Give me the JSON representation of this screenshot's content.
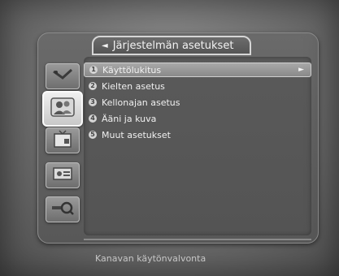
{
  "header": {
    "title": "Järjestelmän asetukset",
    "back_arrow": "◄"
  },
  "menu": {
    "items": [
      {
        "num": "1",
        "label": "Käyttölukitus",
        "selected": true
      },
      {
        "num": "2",
        "label": "Kielten asetus",
        "selected": false
      },
      {
        "num": "3",
        "label": "Kellonajan asetus",
        "selected": false
      },
      {
        "num": "4",
        "label": "Ääni ja kuva",
        "selected": false
      },
      {
        "num": "5",
        "label": "Muut asetukset",
        "selected": false
      }
    ],
    "submenu_arrow": "►"
  },
  "sidebar": {
    "icons": [
      {
        "name": "satellite-dish-icon"
      },
      {
        "name": "user-settings-icon",
        "active": true
      },
      {
        "name": "tv-channel-icon"
      },
      {
        "name": "media-card-icon"
      },
      {
        "name": "search-key-icon"
      }
    ]
  },
  "status": {
    "text": "Kanavan käytönvalvonta"
  }
}
